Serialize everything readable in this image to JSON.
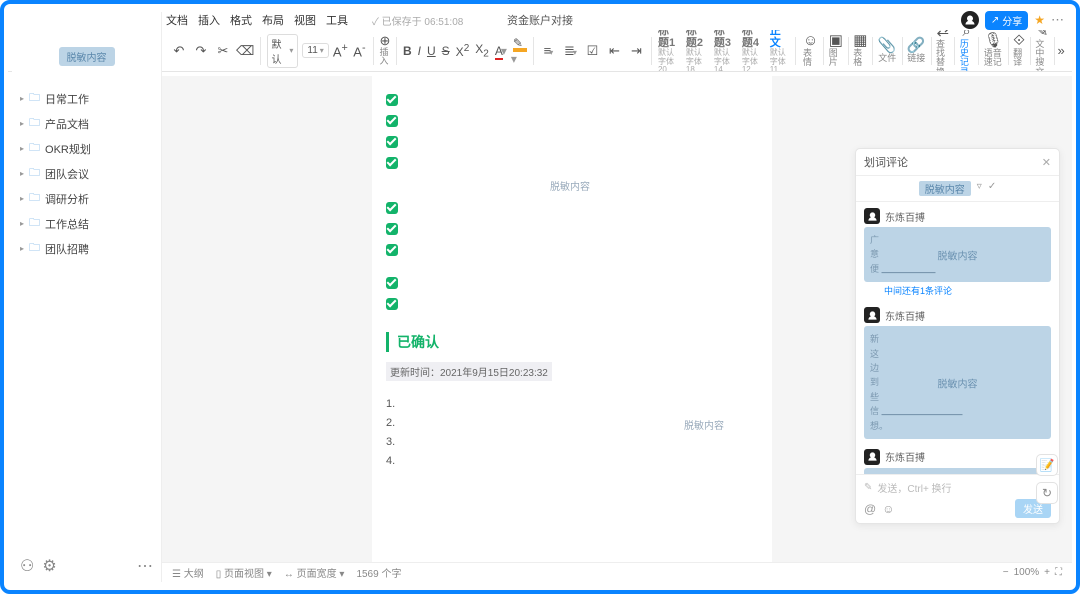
{
  "menu": {
    "items": [
      "文档",
      "插入",
      "格式",
      "布局",
      "视图",
      "工具"
    ],
    "autosave_prefix": "已保存于",
    "autosave_time": "06:51:08",
    "doc_title": "资金账户对接",
    "share_label": "分享"
  },
  "toolbar": {
    "font_family": "默认",
    "font_size": "11",
    "insert_label": "插入",
    "headings": [
      {
        "label": "标题1",
        "sub": "默认字体 20"
      },
      {
        "label": "标题2",
        "sub": "默认字体 18"
      },
      {
        "label": "标题3",
        "sub": "默认字体 14"
      },
      {
        "label": "标题4",
        "sub": "默认字体 12"
      },
      {
        "label": "正文",
        "sub": "默认字体 11",
        "active": true
      }
    ],
    "actions": [
      {
        "icon": "☺",
        "label": "表情"
      },
      {
        "icon": "▣",
        "label": "图片"
      },
      {
        "icon": "▦",
        "label": "表格"
      },
      {
        "icon": "📎",
        "label": "文件"
      },
      {
        "icon": "🔗",
        "label": "链接"
      },
      {
        "icon": "⇄",
        "label": "查找替换"
      },
      {
        "icon": "⌕",
        "label": "历史记录",
        "blue": true
      },
      {
        "icon": "🎙",
        "label": "语音速记"
      },
      {
        "icon": "⟐",
        "label": "翻译"
      },
      {
        "icon": "✎",
        "label": "文中搜文"
      }
    ]
  },
  "sidebar": {
    "redacted": "脱敏内容",
    "folders": [
      "日常工作",
      "产品文档",
      "OKR规划",
      "团队会议",
      "调研分析",
      "工作总结",
      "团队招聘"
    ]
  },
  "outline": {
    "title": "大纲",
    "redacted": "脱敏内容"
  },
  "document": {
    "checks_count_a": 4,
    "checks_count_b": 3,
    "checks_count_c": 2,
    "mid_redact": "脱敏内容",
    "section_title": "已确认",
    "updated_label": "更新时间：",
    "updated_time": "2021年9月15日20:23:32",
    "numbers": [
      "1.",
      "2.",
      "3.",
      "4."
    ],
    "list_redact": "脱敏内容"
  },
  "comments": {
    "panel_title": "划词评论",
    "tab_label": "脱敏内容",
    "author": "东炼百搏",
    "more_note": "中间还有1条评论",
    "redact": "脱敏内容",
    "input_placeholder": "发送，Ctrl+ 换行",
    "send": "发送"
  },
  "status": {
    "outline": "大纲",
    "page_view": "页面视图",
    "page_width": "页面宽度",
    "word_count": "1569 个字",
    "zoom": "100%"
  }
}
